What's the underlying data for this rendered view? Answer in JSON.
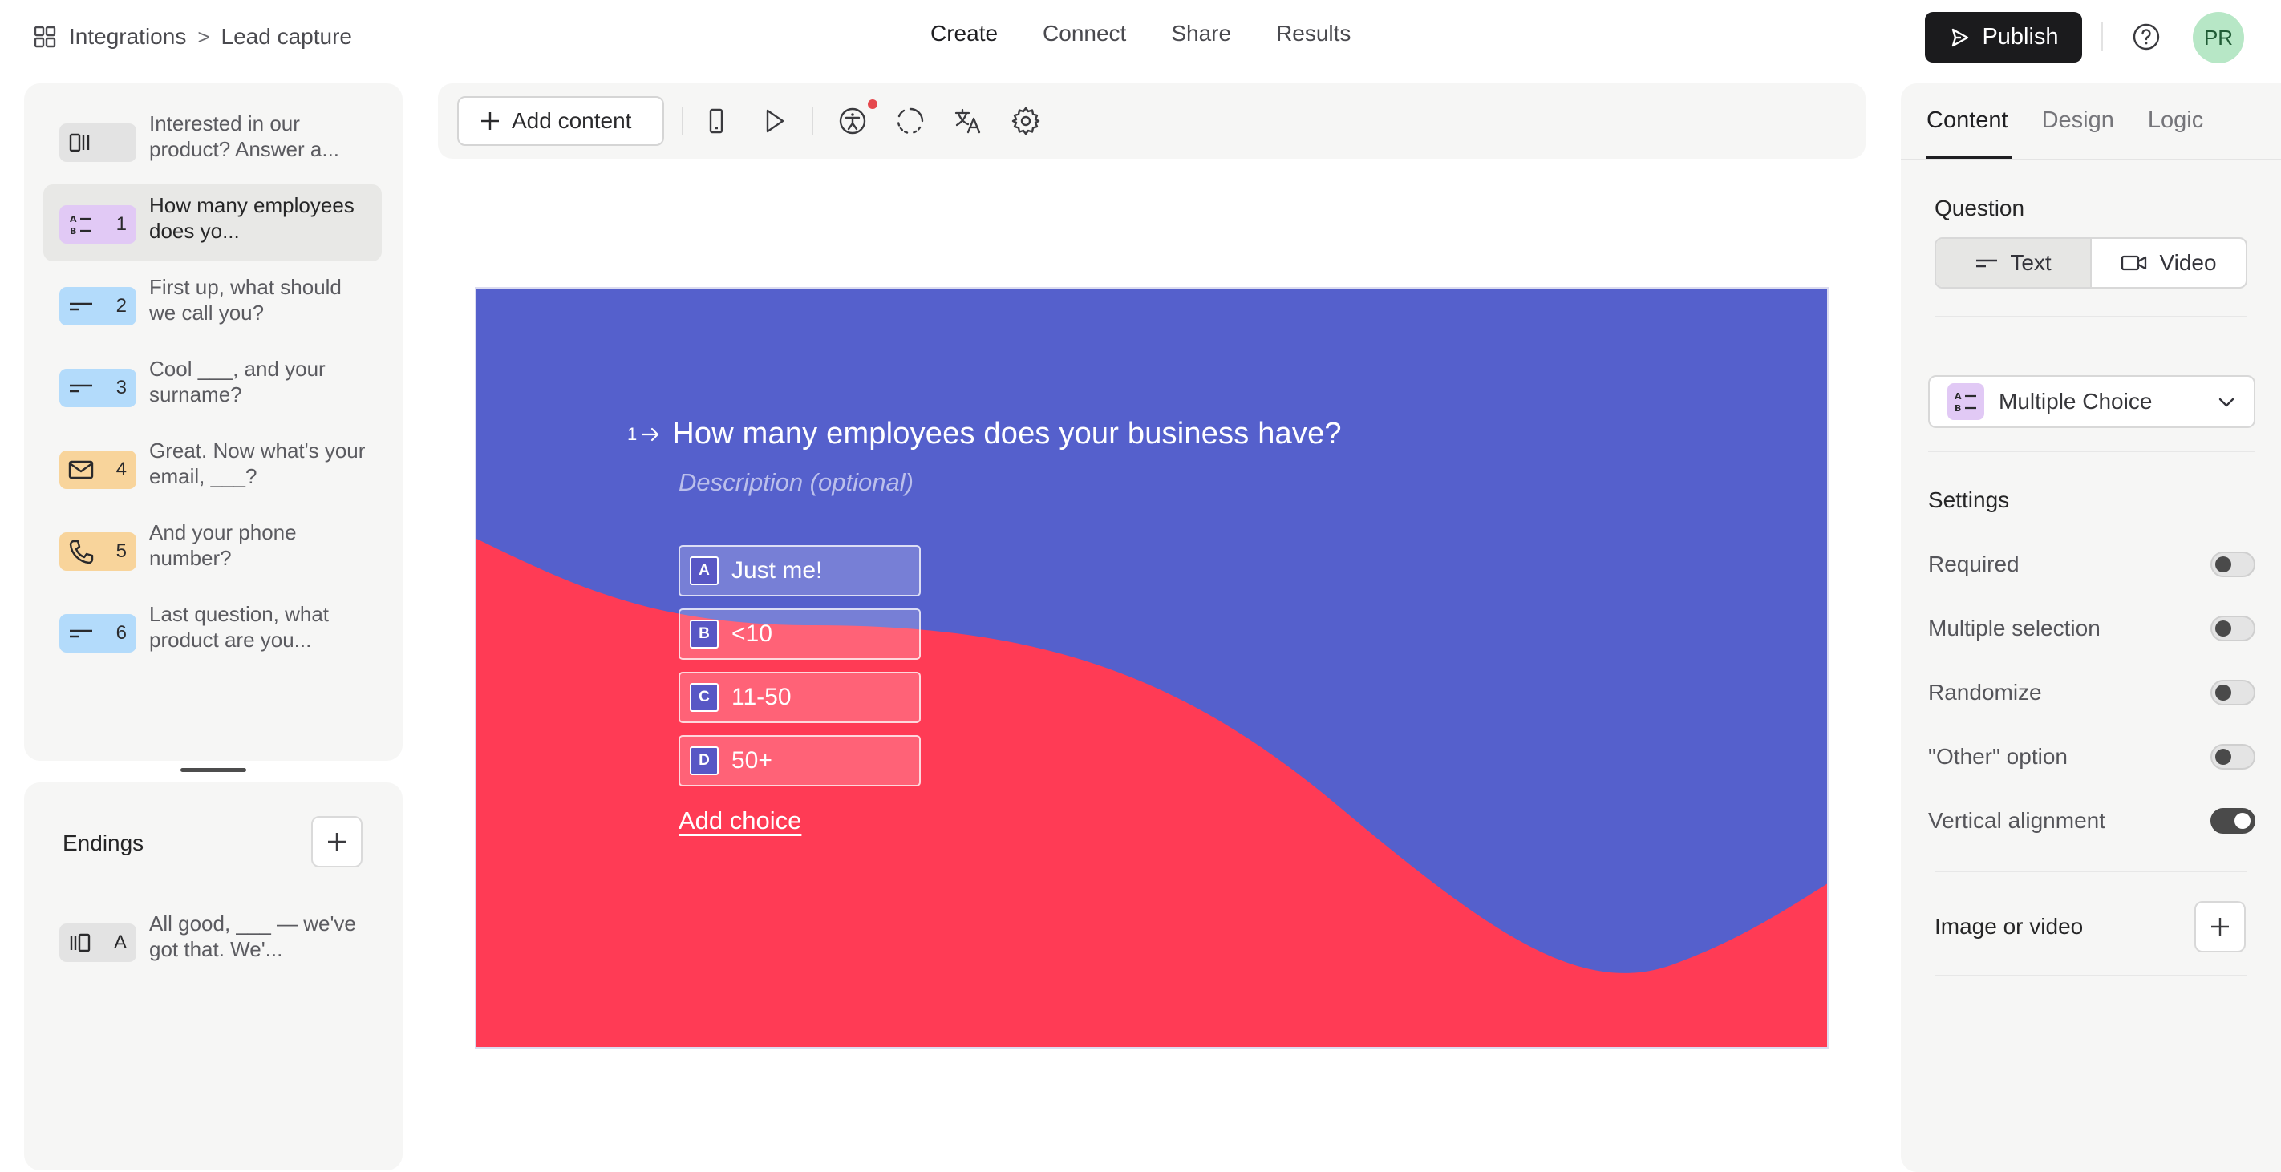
{
  "breadcrumb": {
    "root": "Integrations",
    "separator": ">",
    "current": "Lead capture"
  },
  "nav": {
    "create": "Create",
    "connect": "Connect",
    "share": "Share",
    "results": "Results"
  },
  "publish_label": "Publish",
  "avatar_initials": "PR",
  "questions": [
    {
      "type": "welcome",
      "badge_color": "#e3e3e3",
      "number": "",
      "text": "Interested in our product? Answer a..."
    },
    {
      "type": "multiple-choice",
      "badge_color": "#e1c9f5",
      "number": "1",
      "text": "How many employees does yo...",
      "selected": true
    },
    {
      "type": "short-text",
      "badge_color": "#b3dbfb",
      "number": "2",
      "text": "First up, what should we call you?"
    },
    {
      "type": "short-text",
      "badge_color": "#b3dbfb",
      "number": "3",
      "text": "Cool ___, and your surname?"
    },
    {
      "type": "email",
      "badge_color": "#f8d49b",
      "number": "4",
      "text": "Great. Now what's your email, ___?"
    },
    {
      "type": "phone",
      "badge_color": "#f8d49b",
      "number": "5",
      "text": "And your phone number?"
    },
    {
      "type": "short-text",
      "badge_color": "#b3dbfb",
      "number": "6",
      "text": "Last question, what product are you..."
    }
  ],
  "endings": {
    "title": "Endings",
    "items": [
      {
        "letter": "A",
        "text": "All good, ___ — we've got that. We'..."
      }
    ]
  },
  "toolbar": {
    "add_content_label": "Add content"
  },
  "slide": {
    "question_number": "1",
    "question": "How many employees does your business have?",
    "description_placeholder": "Description (optional)",
    "choices": [
      {
        "key": "A",
        "label": "Just me!"
      },
      {
        "key": "B",
        "label": "<10"
      },
      {
        "key": "C",
        "label": "11-50"
      },
      {
        "key": "D",
        "label": "50+"
      }
    ],
    "add_choice_label": "Add choice",
    "colors": {
      "primary": "#5560cc",
      "secondary": "#ff3b55"
    }
  },
  "right_panel": {
    "tabs": {
      "content": "Content",
      "design": "Design",
      "logic": "Logic"
    },
    "question_heading": "Question",
    "question_format": {
      "text": "Text",
      "video": "Video",
      "selected": "Text"
    },
    "question_type": "Multiple Choice",
    "settings_heading": "Settings",
    "settings": [
      {
        "label": "Required",
        "on": false
      },
      {
        "label": "Multiple selection",
        "on": false
      },
      {
        "label": "Randomize",
        "on": false
      },
      {
        "label": "\"Other\" option",
        "on": false
      },
      {
        "label": "Vertical alignment",
        "on": true
      }
    ],
    "media_heading": "Image or video"
  }
}
